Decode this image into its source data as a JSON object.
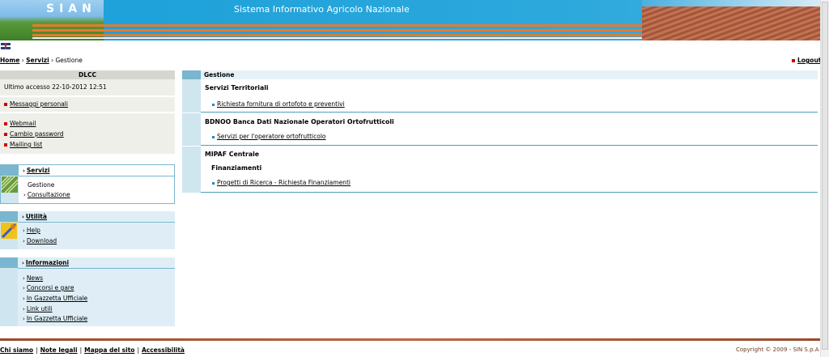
{
  "banner": {
    "logo": "SIAN",
    "title": "Sistema Informativo Agricolo Nazionale",
    "colors": {
      "sky": "#1aa0d8",
      "orange": "#e8792e",
      "field": "#a4553a"
    }
  },
  "breadcrumb": {
    "home": "Home",
    "sep1": "›",
    "servizi": "Servizi",
    "sep2": "›",
    "current": "Gestione"
  },
  "logout": "Logout",
  "user": {
    "name": "DLCC",
    "last_access": "Ultimo accesso 22-10-2012 12:51",
    "messages": "Messaggi personali",
    "links": [
      "Webmail",
      "Cambio password",
      "Mailing list"
    ]
  },
  "panels": {
    "servizi": {
      "title": "Servizi",
      "items": [
        "Gestione",
        "Consultazione"
      ]
    },
    "utilita": {
      "title": "Utilità",
      "items": [
        "Help",
        "Download"
      ]
    },
    "informazioni": {
      "title": "Informazioni",
      "items": [
        "News",
        "Concorsi e gare",
        "In Gazzetta Ufficiale",
        "Link utili",
        "In Gazzetta Ufficiale"
      ]
    }
  },
  "main": {
    "title": "Gestione",
    "sections": [
      {
        "title": "Servizi Territoriali",
        "link": "Richiesta fornitura di ortofoto e preventivi"
      },
      {
        "title": "BDNOO Banca Dati Nazionale Operatori Ortofrutticoli",
        "link": "Servizi per l'operatore ortofrutticolo"
      },
      {
        "title": "MIPAF Centrale",
        "subtitle": "Finanziamenti",
        "link": "Progetti di Ricerca - Richiesta Finanziamenti"
      }
    ]
  },
  "footer": {
    "links": [
      "Chi siamo",
      "Note legali",
      "Mappa del sito",
      "Accessibilità"
    ],
    "separator": "|",
    "copyright": "Copyright © 2009 - SIN S.p.A"
  },
  "icons": [
    "flag-uk-icon",
    "chevron-right-icon",
    "red-bullet-icon",
    "blue-bullet-icon",
    "servizi-panel-icon",
    "utilita-panel-icon"
  ]
}
